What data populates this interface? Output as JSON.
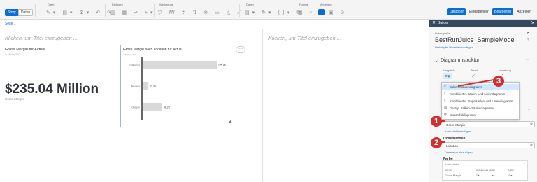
{
  "toolbar": {
    "story_label": "Story",
    "daten_label": "Daten",
    "groups": {
      "datei": "Datei",
      "einfuegen": "Einfügen",
      "werkzeuge": "Werkzeuge",
      "daten": "Daten",
      "format": "Format",
      "anzeigen": "Anzeigen"
    },
    "right_buttons": {
      "designer": "Designer",
      "eingabefilter": "Eingabefilter",
      "bearbeiten": "Bearbeiten",
      "anzeigen": "Anzeigen"
    }
  },
  "page_tab": "Seite 1",
  "canvas": {
    "placeholder_title": "Klicken, um Titel einzugeben ...",
    "placeholder_title_right": "Klicken, um Titel einzugeben ..."
  },
  "kpi": {
    "title": "Gross Margin für Actual",
    "subtitle": "in Million USD",
    "value": "$235.04 Million",
    "caption": "Gross Margin"
  },
  "chart_widget": {
    "title": "Gross Margin nach Location für Actual",
    "subtitle": "in Million USD",
    "more": "···"
  },
  "chart_data": {
    "type": "bar",
    "orientation": "horizontal",
    "categories": [
      "California",
      "Nevada",
      "Oregon"
    ],
    "values": [
      175.46,
      13.35,
      46.23
    ],
    "value_labels": [
      "175.46",
      "13.35",
      "46.23"
    ],
    "title": "Gross Margin nach Location für Actual",
    "xlabel": "",
    "ylabel": "",
    "xlim": [
      0,
      175.46
    ],
    "colors": {
      "bar": "#d9d9d9",
      "axis": "#32363a"
    }
  },
  "builder": {
    "header": "Builder",
    "datasource_label": "Datenquelle",
    "datasource_name": "BestRunJuice_SampleModel",
    "linked_models_link": "Verknüpfte Modelle hinzufügen",
    "section_title": "Diagrammstruktur",
    "type_labels": {
      "vergleich": "Vergleich",
      "trend": "Trend",
      "verteilung": "Verteilung"
    },
    "measure_value": "Gross Margin",
    "add_measure_link": "Kennzahl hinzufügen",
    "dimensions_label": "Dimensionen",
    "dimension_value": "Location",
    "add_dimension_link": "Dimension hinzufügen",
    "farbe_label": "Farbe",
    "farbe_kennzahlen": "Kennzahlen",
    "farbe_table": {
      "col_element": "Element",
      "col_anzeigen": "Anzeigen als Muster",
      "col_farbe": "Farbe",
      "row_label": "Gross Margin"
    }
  },
  "dropdown": {
    "items": [
      {
        "label": "Balken-/Säulendiagramm",
        "icon": "bar-chart-icon",
        "selected": true
      },
      {
        "label": "Kombiniertes Säulen- und Liniendiagramm",
        "icon": "combo-chart-icon",
        "selected": false
      },
      {
        "label": "Kombiniertes Stapelsäulen- und Liniendiagramm",
        "icon": "stacked-combo-chart-icon",
        "selected": false
      },
      {
        "label": "Gestap. Balken-/Säulendiagramm",
        "icon": "stacked-bar-chart-icon",
        "selected": false
      },
      {
        "label": "Wasserfalldiagramm",
        "icon": "waterfall-chart-icon",
        "selected": false
      }
    ]
  },
  "callouts": [
    "1",
    "2",
    "3"
  ],
  "colors": {
    "accent": "#0a6ed1",
    "header": "#354a5f",
    "callout": "#d32f2f"
  }
}
